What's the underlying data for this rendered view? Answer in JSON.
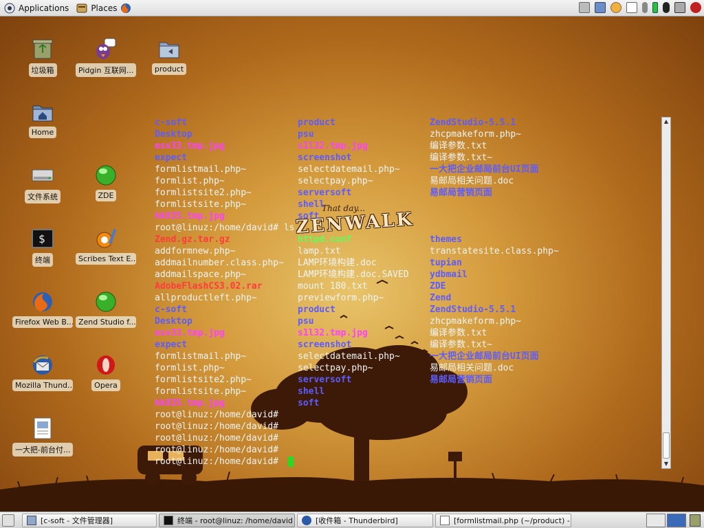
{
  "top_panel": {
    "applications_label": "Applications",
    "places_label": "Places",
    "firefox_icon": "firefox-icon",
    "tray_icons": [
      "printer-icon",
      "network-icon",
      "chat-icon",
      "notes-icon",
      "pin-icon",
      "battery-icon",
      "sync-icon",
      "mute-icon",
      "power-icon"
    ]
  },
  "desktop_icons": [
    {
      "label": "垃圾箱",
      "icon": "trash-icon"
    },
    {
      "label": "Pidgin 互联网...",
      "icon": "pidgin-icon"
    },
    {
      "label": "product",
      "icon": "folder-icon"
    },
    {
      "label": "Home",
      "icon": "home-folder-icon"
    },
    {
      "label": "文件系统",
      "icon": "drive-icon"
    },
    {
      "label": "ZDE",
      "icon": "zde-icon"
    },
    {
      "label": "终端",
      "icon": "terminal-icon"
    },
    {
      "label": "Scribes Text E...",
      "icon": "scribes-icon"
    },
    {
      "label": "Firefox Web B...",
      "icon": "firefox-icon"
    },
    {
      "label": "Zend Studio f...",
      "icon": "zend-icon"
    },
    {
      "label": "Mozilla Thund...",
      "icon": "thunderbird-icon"
    },
    {
      "label": "Opera",
      "icon": "opera-icon"
    },
    {
      "label": "一大把-前台付...",
      "icon": "document-icon"
    }
  ],
  "terminal": {
    "col1": [
      {
        "t": "c-soft",
        "c": "dir"
      },
      {
        "t": "Desktop",
        "c": "dir"
      },
      {
        "t": "esv33.tmp.jpg",
        "c": "img"
      },
      {
        "t": "expect",
        "c": "dir"
      },
      {
        "t": "formlistmail.php~",
        "c": "file"
      },
      {
        "t": "formlist.php~",
        "c": "file"
      },
      {
        "t": "formlistsite2.php~",
        "c": "file"
      },
      {
        "t": "formlistsite.php~",
        "c": "file"
      },
      {
        "t": "hk835.tmp.jpg",
        "c": "img"
      },
      {
        "t": "root@linuz:/home/david# ls",
        "c": "file"
      },
      {
        "t": "Zend.gz.tar.gz",
        "c": "arc"
      },
      {
        "t": "addformnew.php~",
        "c": "file"
      },
      {
        "t": "addmailnumber.class.php~",
        "c": "file"
      },
      {
        "t": "addmailspace.php~",
        "c": "file"
      },
      {
        "t": "AdobeFlashCS3.02.rar",
        "c": "arc"
      },
      {
        "t": "allproductleft.php~",
        "c": "file"
      },
      {
        "t": "c-soft",
        "c": "dir"
      },
      {
        "t": "Desktop",
        "c": "dir"
      },
      {
        "t": "esv33.tmp.jpg",
        "c": "img"
      },
      {
        "t": "expect",
        "c": "dir"
      },
      {
        "t": "formlistmail.php~",
        "c": "file"
      },
      {
        "t": "formlist.php~",
        "c": "file"
      },
      {
        "t": "formlistsite2.php~",
        "c": "file"
      },
      {
        "t": "formlistsite.php~",
        "c": "file"
      },
      {
        "t": "hk835.tmp.jpg",
        "c": "img"
      },
      {
        "t": "root@linuz:/home/david#",
        "c": "file"
      },
      {
        "t": "root@linuz:/home/david#",
        "c": "file"
      },
      {
        "t": "root@linuz:/home/david#",
        "c": "file"
      },
      {
        "t": "root@linuz:/home/david#",
        "c": "file"
      },
      {
        "t": "root@linuz:/home/david#",
        "c": "file"
      }
    ],
    "col2": [
      {
        "t": "product",
        "c": "dir"
      },
      {
        "t": "psu",
        "c": "dir"
      },
      {
        "t": "s1l32.tmp.jpg",
        "c": "img"
      },
      {
        "t": "screenshot",
        "c": "dir"
      },
      {
        "t": "selectdatemail.php~",
        "c": "file"
      },
      {
        "t": "selectpay.php~",
        "c": "file"
      },
      {
        "t": "serversoft",
        "c": "dir"
      },
      {
        "t": "shell",
        "c": "dir"
      },
      {
        "t": "soft",
        "c": "dir"
      },
      {
        "t": "",
        "c": "file"
      },
      {
        "t": "httpd.conf",
        "c": "exec"
      },
      {
        "t": "lamp.txt",
        "c": "file"
      },
      {
        "t": "LAMP环境构建.doc",
        "c": "file"
      },
      {
        "t": "LAMP环境构建.doc.SAVED",
        "c": "file"
      },
      {
        "t": "mount 180.txt",
        "c": "file"
      },
      {
        "t": "previewform.php~",
        "c": "file"
      },
      {
        "t": "product",
        "c": "dir"
      },
      {
        "t": "psu",
        "c": "dir"
      },
      {
        "t": "s1l32.tmp.jpg",
        "c": "img"
      },
      {
        "t": "screenshot",
        "c": "dir"
      },
      {
        "t": "selectdatemail.php~",
        "c": "file"
      },
      {
        "t": "selectpay.php~",
        "c": "file"
      },
      {
        "t": "serversoft",
        "c": "dir"
      },
      {
        "t": "shell",
        "c": "dir"
      },
      {
        "t": "soft",
        "c": "dir"
      }
    ],
    "col3": [
      {
        "t": "ZendStudio-5.5.1",
        "c": "dir"
      },
      {
        "t": "zhcpmakeform.php~",
        "c": "file"
      },
      {
        "t": "编译参数.txt",
        "c": "file"
      },
      {
        "t": "编译参数.txt~",
        "c": "file"
      },
      {
        "t": "一大把企业邮局前台UI页面",
        "c": "dir"
      },
      {
        "t": "易邮局相关问题.doc",
        "c": "file"
      },
      {
        "t": "易邮局营销页面",
        "c": "dir"
      },
      {
        "t": "",
        "c": "file"
      },
      {
        "t": "",
        "c": "file"
      },
      {
        "t": "",
        "c": "file"
      },
      {
        "t": "themes",
        "c": "dir"
      },
      {
        "t": "transtatesite.class.php~",
        "c": "file"
      },
      {
        "t": "tupian",
        "c": "dir"
      },
      {
        "t": "ydbmail",
        "c": "dir"
      },
      {
        "t": "ZDE",
        "c": "dir"
      },
      {
        "t": "Zend",
        "c": "dir"
      },
      {
        "t": "ZendStudio-5.5.1",
        "c": "dir"
      },
      {
        "t": "zhcpmakeform.php~",
        "c": "file"
      },
      {
        "t": "编译参数.txt",
        "c": "file"
      },
      {
        "t": "编译参数.txt~",
        "c": "file"
      },
      {
        "t": "一大把企业邮局前台UI页面",
        "c": "dir"
      },
      {
        "t": "易邮局相关问题.doc",
        "c": "file"
      },
      {
        "t": "易邮局营销页面",
        "c": "dir"
      }
    ]
  },
  "wallpaper": {
    "tagline": "That day...",
    "logo": "ZENWALK"
  },
  "taskbar": [
    {
      "label": "[c-soft - 文件管理器]",
      "icon": "folder-icon",
      "active": false
    },
    {
      "label": "终端 - root@linuz: /home/david",
      "icon": "terminal-icon",
      "active": true
    },
    {
      "label": "[收件箱 - Thunderbird]",
      "icon": "thunderbird-icon",
      "active": false
    },
    {
      "label": "[formlistmail.php (~/product) - g...",
      "icon": "editor-icon",
      "active": false
    }
  ],
  "colors": {
    "dir": "#5c5cff",
    "img": "#ff40ff",
    "arc": "#ff3c3c",
    "exec": "#5cff5c",
    "file": "#f4f4f4",
    "cursor": "#22dd22"
  }
}
